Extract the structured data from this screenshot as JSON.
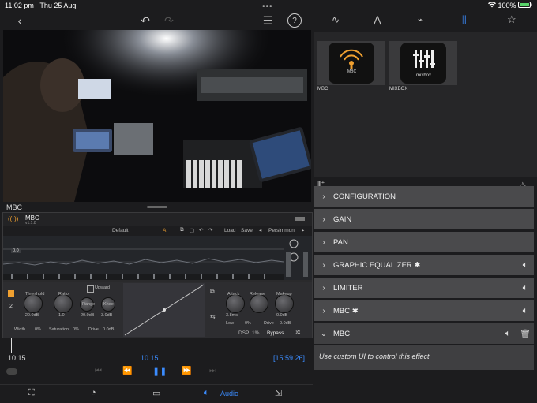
{
  "status": {
    "time": "11:02 pm",
    "date": "Thu 25 Aug",
    "dots": "•••",
    "battery": "100%"
  },
  "left_toolbar": {
    "back": "‹",
    "undo": "↶",
    "redo": "↷",
    "list": "☰",
    "help": "?"
  },
  "plugin_title": "MBC",
  "plugin_ui": {
    "name": "MBC",
    "version": "v1.1.8",
    "preset": "Default",
    "preset_a": "A",
    "load": "Load",
    "save": "Save",
    "brand": "Persimmon",
    "gain_value": "0.0",
    "band_number": "2",
    "mode": "Upward",
    "threshold_label": "Threshold",
    "threshold_value": "-20.0dB",
    "ratio_label": "Ratio",
    "ratio_value": "1.0",
    "range_label": "Range",
    "range_value": "20.0dB",
    "knee_label": "Knee",
    "knee_value": "3.0dB",
    "attack_label": "Attack",
    "attack_value": "3.8ms",
    "release_label": "Release",
    "makeup_label": "Makeup",
    "makeup_value": "0.0dB",
    "width_label": "Width",
    "width_value": "0%",
    "saturation_label": "Saturation",
    "saturation_value": "0%",
    "drive_label": "Drive",
    "drive_value": "0.0dB",
    "low_label": "Low",
    "low_value": "0%",
    "drive2_label": "Drive",
    "drive2_value": "0.0dB",
    "dsp": "DSP: 1%",
    "bypass": "Bypass"
  },
  "transport": {
    "time_left": "10.15",
    "time_center": "10.15",
    "time_right": "[15:59.26]"
  },
  "bottom_bar": {
    "audio_label": "Audio"
  },
  "right_tabs": [
    "tab-waveform",
    "tab-mountains",
    "tab-envelope",
    "tab-effects",
    "tab-favorites"
  ],
  "plugins": [
    {
      "name": "MBC",
      "caption": "MBC"
    },
    {
      "name": "MIXBOX",
      "caption": "MIXBOX"
    }
  ],
  "effects_rows": [
    {
      "label": "CONFIGURATION",
      "has_icon": false
    },
    {
      "label": "GAIN",
      "has_icon": false
    },
    {
      "label": "PAN",
      "has_icon": false
    },
    {
      "label": "GRAPHIC EQUALIZER ✱",
      "has_icon": true
    },
    {
      "label": "LIMITER",
      "has_icon": true
    },
    {
      "label": "MBC ✱",
      "has_icon": true
    },
    {
      "label": "MBC",
      "has_icon": true
    }
  ],
  "expanded_note": "Use custom UI to control this effect",
  "colors": {
    "accent": "#3b8cff",
    "mbc_orange": "#f0a030",
    "row_bg": "#4a4a4c"
  }
}
